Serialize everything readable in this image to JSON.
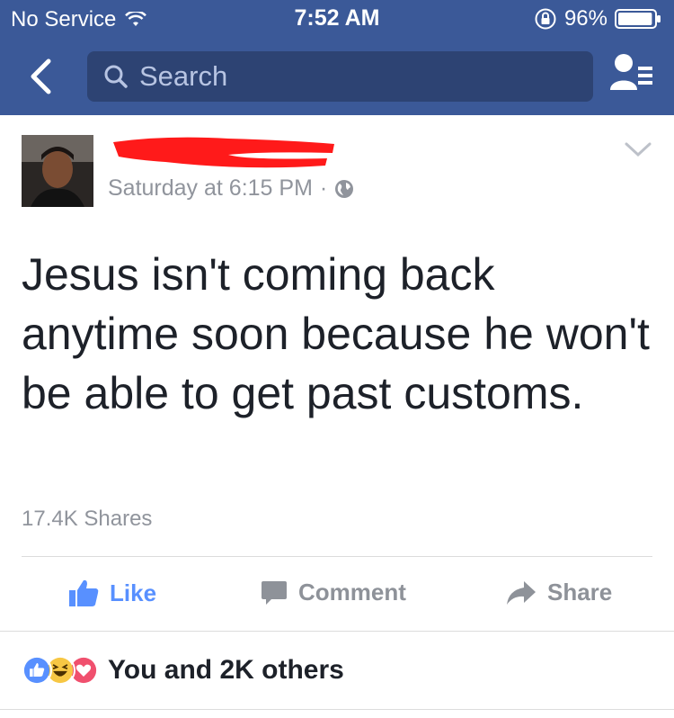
{
  "status_bar": {
    "carrier": "No Service",
    "time": "7:52 AM",
    "battery_percent": "96%",
    "battery_level": 0.96
  },
  "nav": {
    "search_placeholder": "Search"
  },
  "post": {
    "author_redacted": true,
    "timestamp": "Saturday at 6:15 PM",
    "separator": "·",
    "text": "Jesus isn't coming back anytime soon because he won't be able to get past customs.",
    "shares": "17.4K Shares"
  },
  "actions": {
    "like": "Like",
    "comment": "Comment",
    "share": "Share"
  },
  "reactions": {
    "summary": "You and 2K others",
    "types": [
      "like",
      "haha",
      "love"
    ]
  },
  "colors": {
    "brand": "#3b5998",
    "like_blue": "#5890ff",
    "muted": "#90949c",
    "redaction": "#ff1a1a"
  }
}
